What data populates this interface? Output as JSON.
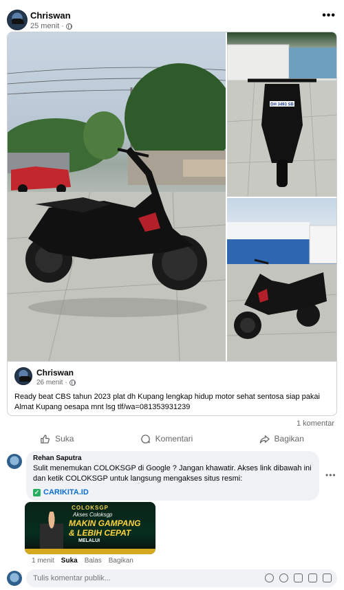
{
  "post": {
    "author": "Chriswan",
    "time": "25 menit",
    "more_label": "•••"
  },
  "shared": {
    "author": "Chriswan",
    "time": "26 menit",
    "text": "Ready beat CBS tahun 2023 plat dh Kupang lengkap hidup motor sehat sentosa siap pakai Almat Kupang oesapa mnt lsg tlf/wa=081353931239",
    "plate": "DH 3493 SB"
  },
  "stats": {
    "comments": "1 komentar"
  },
  "actions": {
    "like": "Suka",
    "comment": "Komentari",
    "share": "Bagikan"
  },
  "comment": {
    "name": "Rehan Saputra",
    "text": "Sulit menemukan COLOKSGP di Google ? Jangan khawatir. Akses link dibawah ini dan ketik COLOKSGP untuk langsung mengakses situs resmi:",
    "link": "CARIKITA.ID",
    "more": "•••",
    "time": "1 menit",
    "like": "Suka",
    "reply": "Balas",
    "share": "Bagikan"
  },
  "ad": {
    "brand": "COLOKSGP",
    "line1": "Akses Coloksgp",
    "line2": "MAKIN GAMPANG",
    "line3": "& LEBIH CEPAT",
    "line4": "MELALUI"
  },
  "composer": {
    "placeholder": "Tulis komentar publik..."
  }
}
